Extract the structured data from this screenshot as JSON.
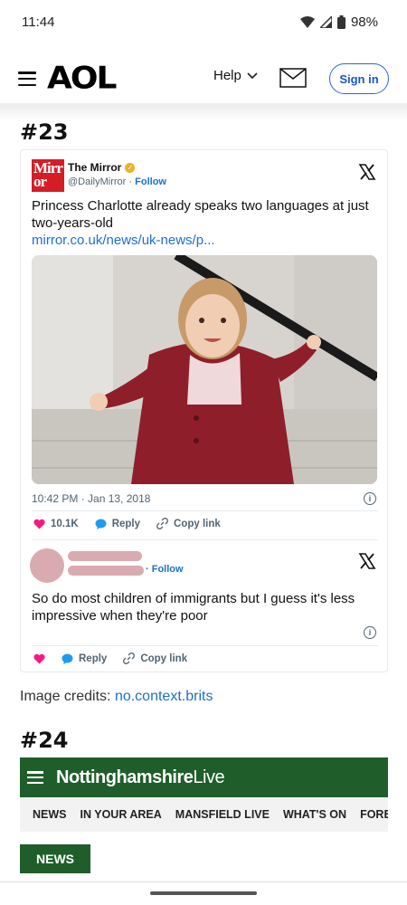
{
  "status_bar": {
    "time": "11:44",
    "battery": "98%"
  },
  "header": {
    "logo": "AOL",
    "help_label": "Help",
    "signin_label": "Sign in"
  },
  "item23": {
    "heading": "#23",
    "tweet": {
      "account_name": "The Mirror",
      "logo_text": "Mirr or",
      "handle": "@DailyMirror",
      "follow": "Follow",
      "text": "Princess Charlotte already speaks two languages at just two-years-old",
      "link": "mirror.co.uk/news/uk-news/p...",
      "timestamp": "10:42 PM · Jan 13, 2018",
      "likes": "10.1K",
      "reply_label": "Reply",
      "copy_label": "Copy link"
    },
    "reply": {
      "follow": "· Follow",
      "text": "So do most children of immigrants but I guess it's less impressive when they're poor",
      "reply_label": "Reply",
      "copy_label": "Copy link"
    },
    "credits_label": "Image credits:",
    "credits_link": "no.context.brits"
  },
  "item24": {
    "heading": "#24",
    "site_name_bold": "Nottinghamshire",
    "site_name_light": "Live",
    "nav": [
      "NEWS",
      "IN YOUR AREA",
      "MANSFIELD LIVE",
      "WHAT'S ON",
      "FORES"
    ],
    "news_button": "NEWS"
  },
  "colors": {
    "aol_blue": "#2a66d8",
    "twitter_blue": "#1d6fd0",
    "like_pink": "#f91880",
    "nl_green": "#1f5e2a",
    "mirror_red": "#d51d27"
  }
}
